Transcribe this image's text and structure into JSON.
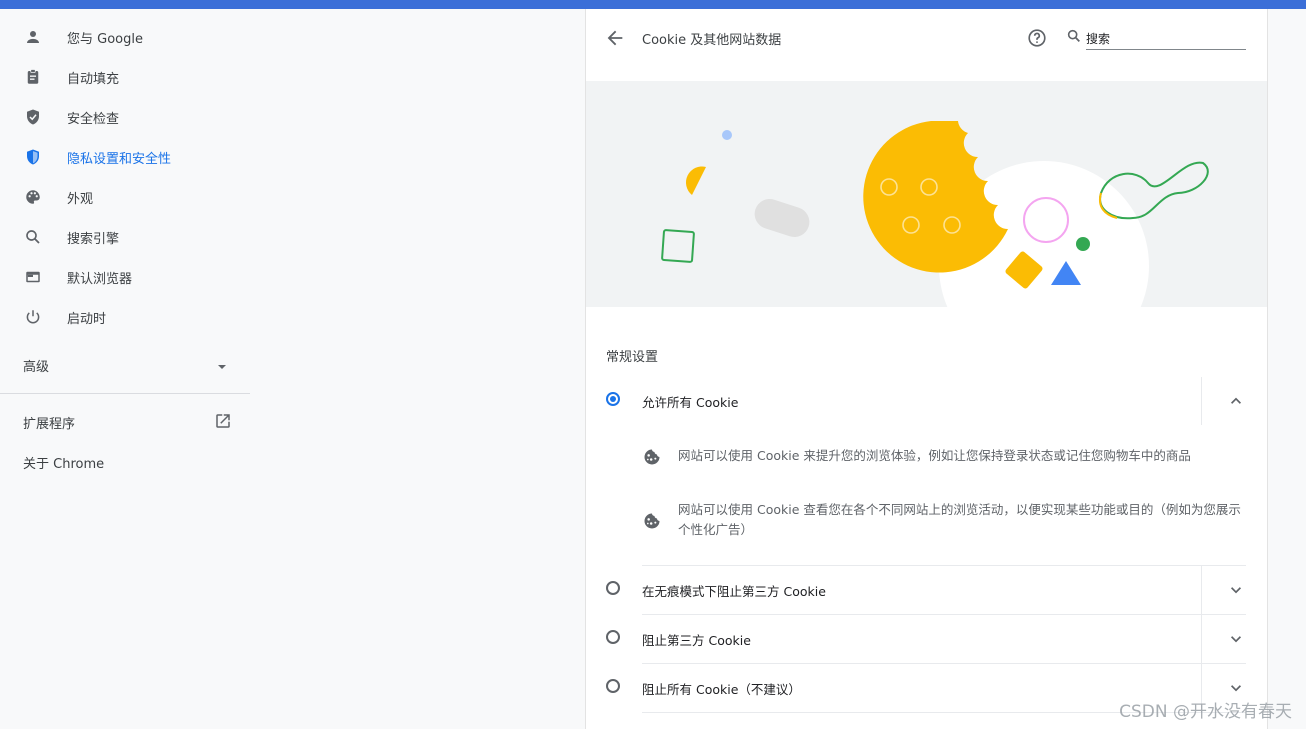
{
  "sidebar": {
    "items": [
      {
        "label": "您与 Google",
        "icon": "person-icon",
        "active": false
      },
      {
        "label": "自动填充",
        "icon": "clipboard-icon",
        "active": false
      },
      {
        "label": "安全检查",
        "icon": "shield-check-icon",
        "active": false
      },
      {
        "label": "隐私设置和安全性",
        "icon": "privacy-shield-icon",
        "active": true
      },
      {
        "label": "外观",
        "icon": "palette-icon",
        "active": false
      },
      {
        "label": "搜索引擎",
        "icon": "search-icon",
        "active": false
      },
      {
        "label": "默认浏览器",
        "icon": "browser-icon",
        "active": false
      },
      {
        "label": "启动时",
        "icon": "power-icon",
        "active": false
      }
    ],
    "advanced_label": "高级",
    "extensions_label": "扩展程序",
    "about_label": "关于 Chrome"
  },
  "header": {
    "title": "Cookie 及其他网站数据",
    "search_value": "搜索"
  },
  "section": {
    "label": "常规设置"
  },
  "options": [
    {
      "label": "允许所有 Cookie",
      "checked": true,
      "expanded": true
    },
    {
      "label": "在无痕模式下阻止第三方 Cookie",
      "checked": false,
      "expanded": false
    },
    {
      "label": "阻止第三方 Cookie",
      "checked": false,
      "expanded": false
    },
    {
      "label": "阻止所有 Cookie（不建议）",
      "checked": false,
      "expanded": false
    }
  ],
  "expanded_details": [
    "网站可以使用 Cookie 来提升您的浏览体验，例如让您保持登录状态或记住您购物车中的商品",
    "网站可以使用 Cookie 查看您在各个不同网站上的浏览活动，以便实现某些功能或目的（例如为您展示个性化广告）"
  ],
  "colors": {
    "accent": "#1a73e8",
    "top_bar": "#3b6fd8",
    "cookie_yellow": "#fbbc04",
    "green": "#34a853"
  },
  "watermark": "CSDN @开水没有春天"
}
